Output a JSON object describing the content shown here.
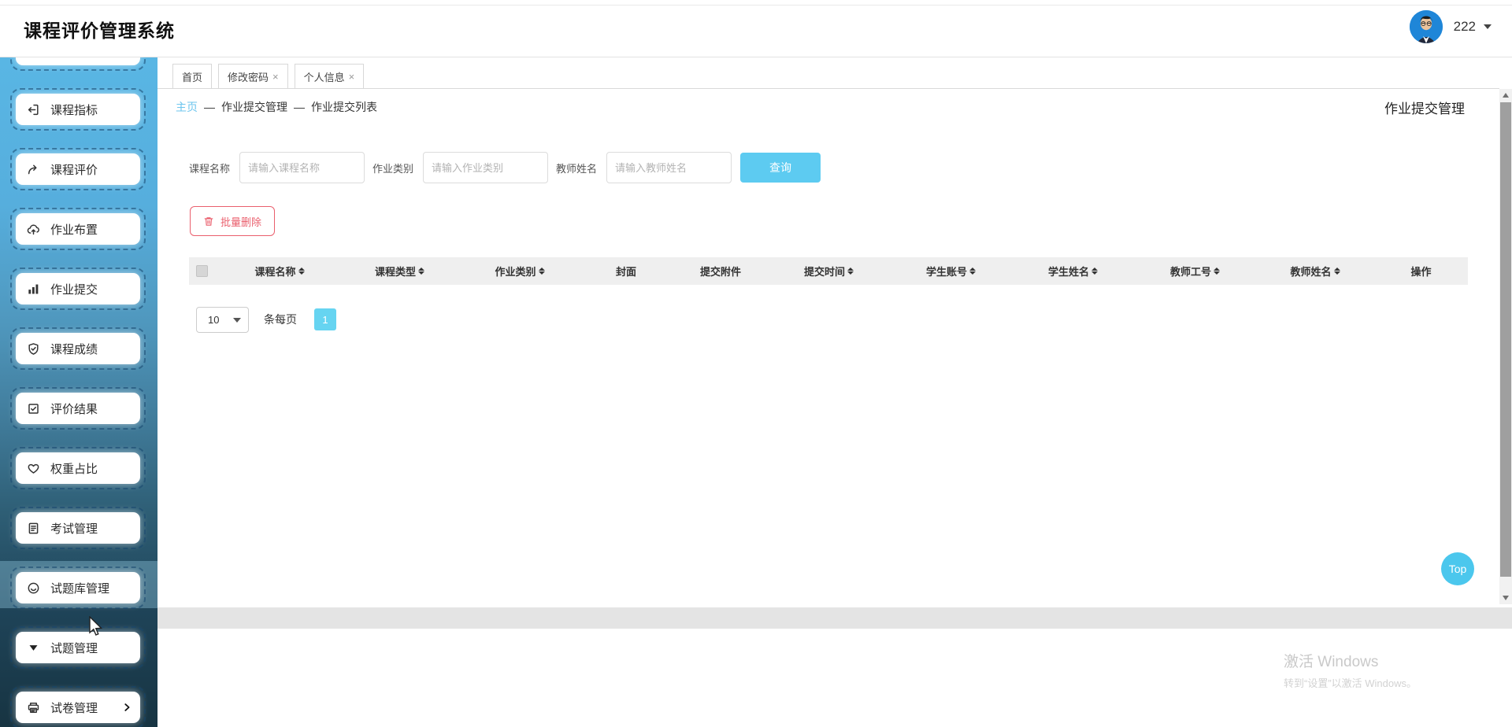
{
  "app": {
    "title": "课程评价管理系统",
    "user": {
      "name": "222"
    }
  },
  "sidebar": {
    "items": [
      {
        "label": "",
        "icon": "hidden-icon",
        "partial": true
      },
      {
        "label": "课程指标",
        "icon": "import-icon"
      },
      {
        "label": "课程评价",
        "icon": "share-icon"
      },
      {
        "label": "作业布置",
        "icon": "cloud-upload-icon"
      },
      {
        "label": "作业提交",
        "icon": "bar-chart-icon"
      },
      {
        "label": "课程成绩",
        "icon": "shield-check-icon"
      },
      {
        "label": "评价结果",
        "icon": "doc-check-icon"
      },
      {
        "label": "权重占比",
        "icon": "heart-icon"
      },
      {
        "label": "考试管理",
        "icon": "document-icon"
      },
      {
        "label": "试题库管理",
        "icon": "smiley-icon",
        "active": true
      },
      {
        "label": "试题管理",
        "icon": "caret-down-icon"
      },
      {
        "label": "试卷管理",
        "icon": "printer-icon",
        "chevron": true
      }
    ]
  },
  "tabs": {
    "close_glyph": "×",
    "items": [
      {
        "label": "首页",
        "closable": false
      },
      {
        "label": "修改密码",
        "closable": true
      },
      {
        "label": "个人信息",
        "closable": true
      }
    ]
  },
  "breadcrumb": {
    "home": "主页",
    "separator": "—",
    "crumbs": [
      "作业提交管理",
      "作业提交列表"
    ]
  },
  "page_title": "作业提交管理",
  "search": {
    "fields": [
      {
        "label": "课程名称",
        "placeholder": "请输入课程名称",
        "value": ""
      },
      {
        "label": "作业类别",
        "placeholder": "请输入作业类别",
        "value": ""
      },
      {
        "label": "教师姓名",
        "placeholder": "请输入教师姓名",
        "value": ""
      }
    ],
    "submit_label": "查询"
  },
  "toolbar": {
    "batch_delete_label": "批量删除"
  },
  "table": {
    "columns": [
      {
        "label": "课程名称",
        "sortable": true
      },
      {
        "label": "课程类型",
        "sortable": true
      },
      {
        "label": "作业类别",
        "sortable": true
      },
      {
        "label": "封面",
        "sortable": false
      },
      {
        "label": "提交附件",
        "sortable": false
      },
      {
        "label": "提交时间",
        "sortable": true
      },
      {
        "label": "学生账号",
        "sortable": true
      },
      {
        "label": "学生姓名",
        "sortable": true
      },
      {
        "label": "教师工号",
        "sortable": true
      },
      {
        "label": "教师姓名",
        "sortable": true
      },
      {
        "label": "操作",
        "sortable": false
      }
    ],
    "rows": []
  },
  "pagination": {
    "page_size": "10",
    "per_page_label": "条每页",
    "pages": [
      "1"
    ]
  },
  "floating": {
    "top_label": "Top"
  },
  "watermark": {
    "line1": "激活 Windows",
    "line2": "转到“设置”以激活 Windows。"
  },
  "colors": {
    "accent_cyan": "#5dcbf1",
    "page_button_cyan": "#66d4f1",
    "top_button_cyan": "#4bc7ed",
    "danger_red": "#ea5f6d",
    "breadcrumb_link": "#6cc5ee",
    "table_header_bg": "#efefef",
    "footer_band": "#e4e4e4"
  }
}
